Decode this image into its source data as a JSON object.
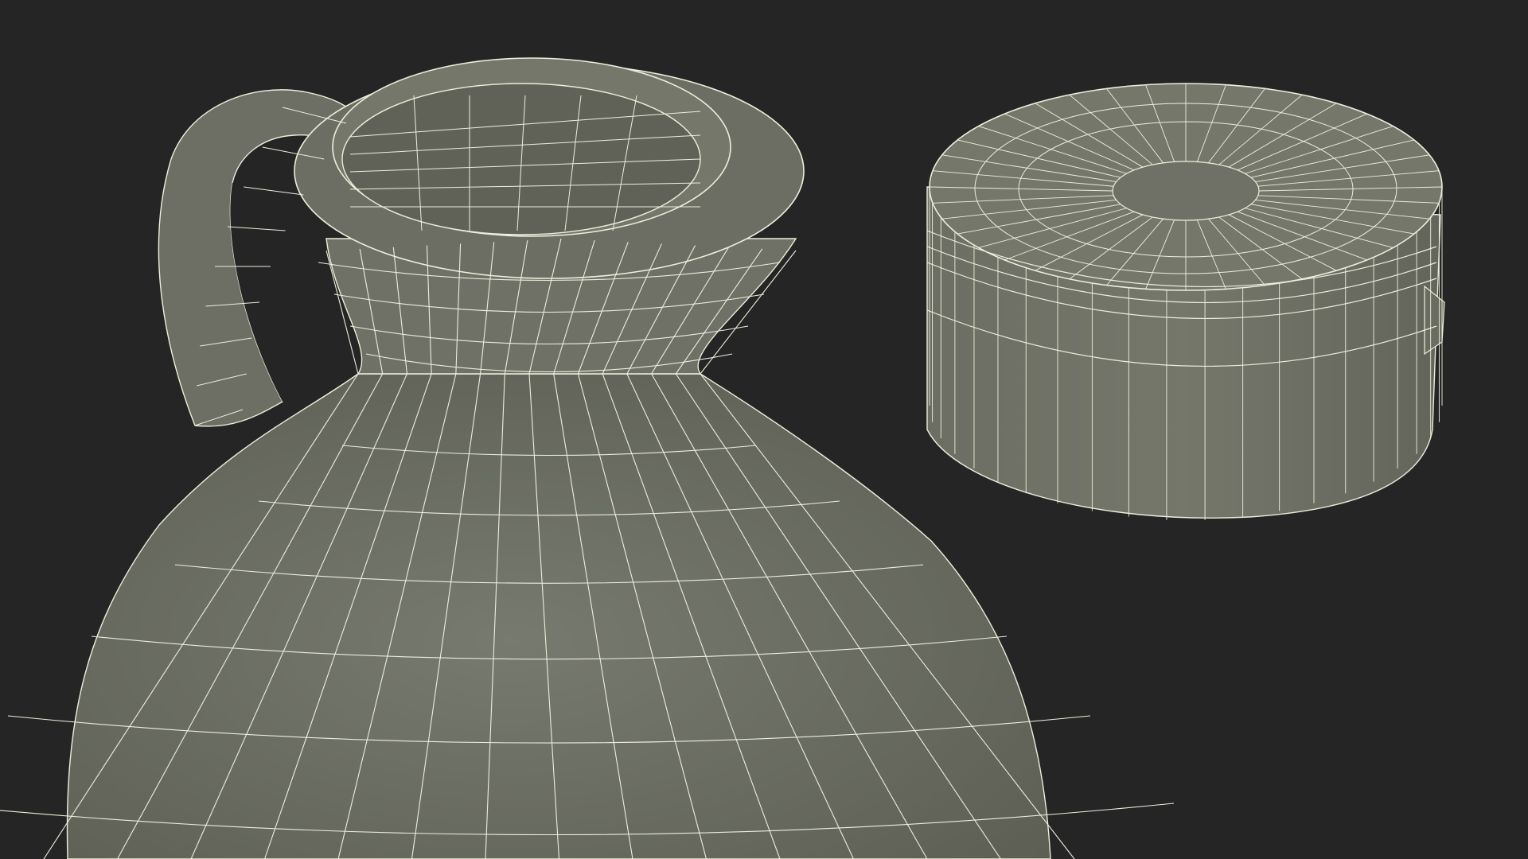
{
  "scene": {
    "background_color": "#252525",
    "mesh_fill_color": "#6f7166",
    "mesh_fill_dark_color": "#55574d",
    "wire_color": "#ecefdc",
    "objects": [
      {
        "name": "jug",
        "kind": "wireframe-mesh"
      },
      {
        "name": "cap",
        "kind": "wireframe-mesh"
      }
    ]
  }
}
